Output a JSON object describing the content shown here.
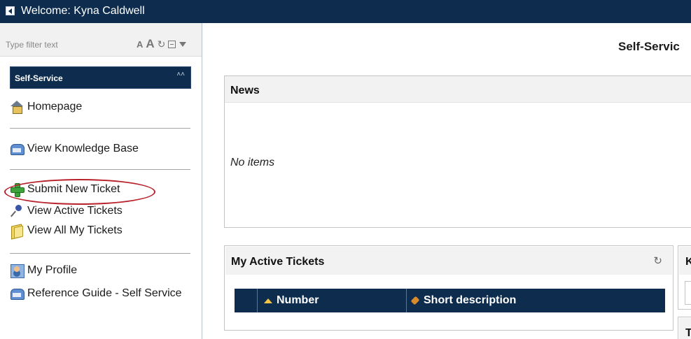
{
  "header": {
    "welcome_text": "Welcome: Kyna Caldwell"
  },
  "filter": {
    "placeholder": "Type filter text",
    "font_small_glyph": "A",
    "font_large_glyph": "A",
    "refresh_glyph": "↻"
  },
  "nav": {
    "section_title": "Self-Service",
    "section_chevron": "˄˄",
    "items": {
      "homepage": "Homepage",
      "knowledge_base": "View Knowledge Base",
      "submit_ticket": "Submit New Ticket",
      "active_tickets": "View Active Tickets",
      "all_tickets": "View All My Tickets",
      "profile": "My Profile",
      "reference_guide": "Reference Guide - Self Service"
    }
  },
  "main": {
    "page_title": "Self-Servic",
    "news": {
      "title": "News",
      "empty_text": "No items"
    },
    "active_tickets": {
      "title": "My Active Tickets",
      "refresh_glyph": "↻",
      "columns": [
        "Number",
        "Short description"
      ]
    },
    "side_panel_initial": "K",
    "side_panel2_initial": "T"
  },
  "colors": {
    "brand_navy": "#0d2c4e",
    "highlight_red": "#b8202a",
    "panel_header_gray": "#f2f2f2"
  },
  "icons": [
    "home-icon",
    "knowledge-base-icon",
    "add-icon",
    "pin-icon",
    "folder-icon",
    "profile-icon",
    "guide-icon"
  ]
}
